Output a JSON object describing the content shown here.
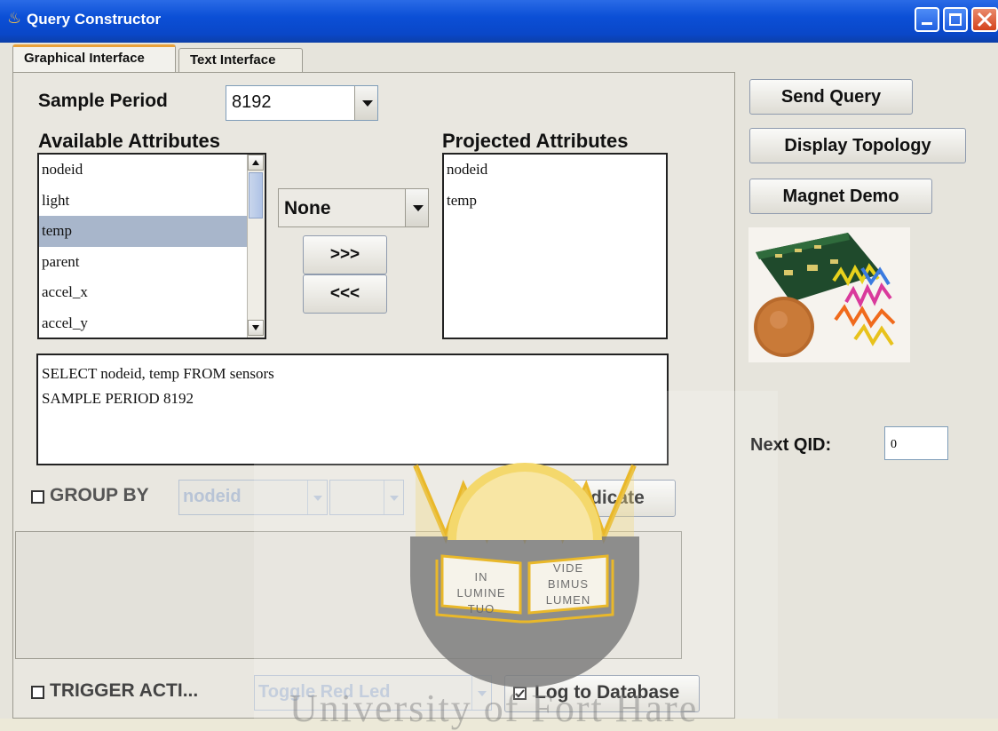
{
  "window": {
    "title": "Query Constructor"
  },
  "tabs": [
    {
      "label": "Graphical Interface",
      "active": true
    },
    {
      "label": "Text Interface",
      "active": false
    }
  ],
  "sample_period": {
    "label": "Sample Period",
    "value": "8192"
  },
  "available_attributes": {
    "label": "Available Attributes",
    "items": [
      "nodeid",
      "light",
      "temp",
      "parent",
      "accel_x",
      "accel_y"
    ],
    "selected": "temp"
  },
  "aggregate_combo": {
    "value": "None"
  },
  "move_buttons": {
    "add": ">>>",
    "remove": "<<<"
  },
  "projected_attributes": {
    "label": "Projected Attributes",
    "items": [
      "nodeid",
      "temp"
    ]
  },
  "query_text": {
    "line1": "SELECT nodeid, temp FROM sensors",
    "line2": "SAMPLE PERIOD 8192"
  },
  "group_by": {
    "label": "GROUP BY",
    "field_value": "nodeid",
    "checked": false
  },
  "new_predicate_label": "New Predicate",
  "trigger": {
    "label": "TRIGGER ACTI...",
    "action_value": "Toggle Red Led",
    "checked": false
  },
  "log_to_database": {
    "label": "Log to Database",
    "checked": true
  },
  "side_buttons": {
    "send_query": "Send Query",
    "display_topology": "Display Topology",
    "magnet_demo": "Magnet Demo"
  },
  "next_qid": {
    "label": "Next QID:",
    "value": "0"
  },
  "watermark": {
    "motto_left": [
      "IN",
      "LUMINE",
      "TUO"
    ],
    "motto_right": [
      "VIDE",
      "BIMUS",
      "LUMEN"
    ],
    "text": "University of Fort Hare"
  },
  "colors": {
    "titlebar": "#0B4FD6",
    "selection": "#A8B6CB",
    "tab_accent": "#E8A13A",
    "crest_gold": "#E9B82A",
    "crest_shadow": "#7A7A7A"
  }
}
